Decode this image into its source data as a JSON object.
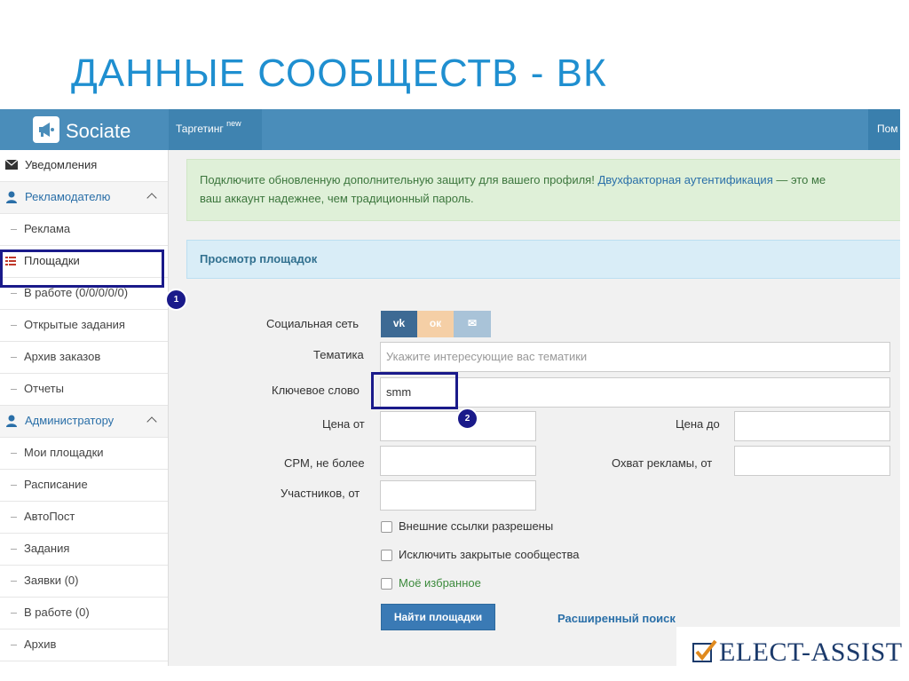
{
  "slide": {
    "title": "ДАННЫЕ СООБЩЕСТВ - ВК"
  },
  "app": {
    "name": "Sociate"
  },
  "topnav": {
    "targeting": "Таргетинг",
    "targeting_badge": "new",
    "help": "Пом"
  },
  "sidebar": {
    "notifications": "Уведомления",
    "advertiser": "Рекламодателю",
    "advertiser_items": [
      "Реклама",
      "Площадки",
      "В работе (0/0/0/0/0)",
      "Открытые задания",
      "Архив заказов",
      "Отчеты"
    ],
    "admin": "Администратору",
    "admin_items": [
      "Мои площадки",
      "Расписание",
      "АвтоПост",
      "Задания",
      "Заявки (0)",
      "В работе (0)",
      "Архив"
    ]
  },
  "alert": {
    "line1_prefix": "Подключите обновленную дополнительную защиту для вашего профиля! ",
    "line1_link": "Двухфакторная аутентификация",
    "line1_suffix": " — это ме",
    "line2": "ваш аккаунт надежнее, чем традиционный пароль."
  },
  "panel": {
    "title": "Просмотр площадок"
  },
  "form": {
    "social_label": "Социальная сеть",
    "social_networks": [
      "vk-icon",
      "odnoklassniki-icon",
      "mail-icon"
    ],
    "topic_label": "Тематика",
    "topic_placeholder": "Укажите интересующие вас тематики",
    "keyword_label": "Ключевое слово",
    "keyword_value": "smm",
    "price_from_label": "Цена от",
    "price_to_label": "Цена до",
    "cpm_label": "CPM, не более",
    "reach_label": "Охват рекламы, от",
    "members_label": "Участников, от",
    "check_external": "Внешние ссылки разрешены",
    "check_exclude_closed": "Исключить закрытые сообщества",
    "check_favorites": "Моё избранное",
    "search_button": "Найти площадки",
    "advanced_link": "Расширенный поиск"
  },
  "callouts": [
    "1",
    "2"
  ],
  "watermark": {
    "text": "ELECT-ASSIST"
  },
  "colors": {
    "accent": "#1f8fd0",
    "topbar": "#4a8dba",
    "callout": "#1a1a8a"
  }
}
